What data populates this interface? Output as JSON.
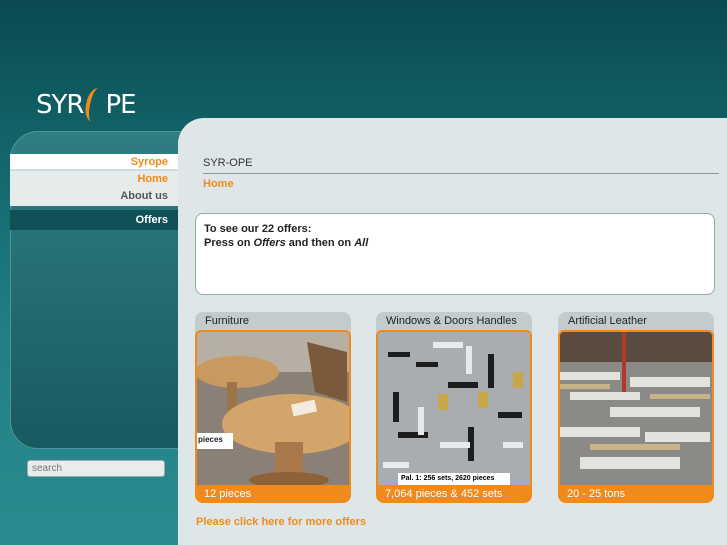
{
  "logo": {
    "left": "SYR",
    "right": "PE"
  },
  "nav": {
    "section": "Syrope",
    "home": "Home",
    "about": "About us",
    "offers": "Offers"
  },
  "search": {
    "placeholder": "search"
  },
  "main": {
    "site_name": "SYR-OPE",
    "breadcrumb": "Home",
    "notice": {
      "line1": "To see our 22 offers:",
      "press_on": "Press on ",
      "offers_word": "Offers",
      "then_on": " and then on ",
      "all_word": "All"
    },
    "cards": [
      {
        "title": "Furniture",
        "caption": "12 pieces",
        "image_label": "pieces"
      },
      {
        "title": "Windows & Doors Handles",
        "caption": "7,064 pieces & 452 sets",
        "image_label": "Pal. 1: 256 sets, 2620 pieces"
      },
      {
        "title": "Artificial Leather",
        "caption": "20 - 25 tons"
      }
    ],
    "more_link": "Please click here for more offers"
  },
  "colors": {
    "accent": "#f08a1a",
    "background": "#13676c",
    "panel": "#dfe6e8"
  }
}
